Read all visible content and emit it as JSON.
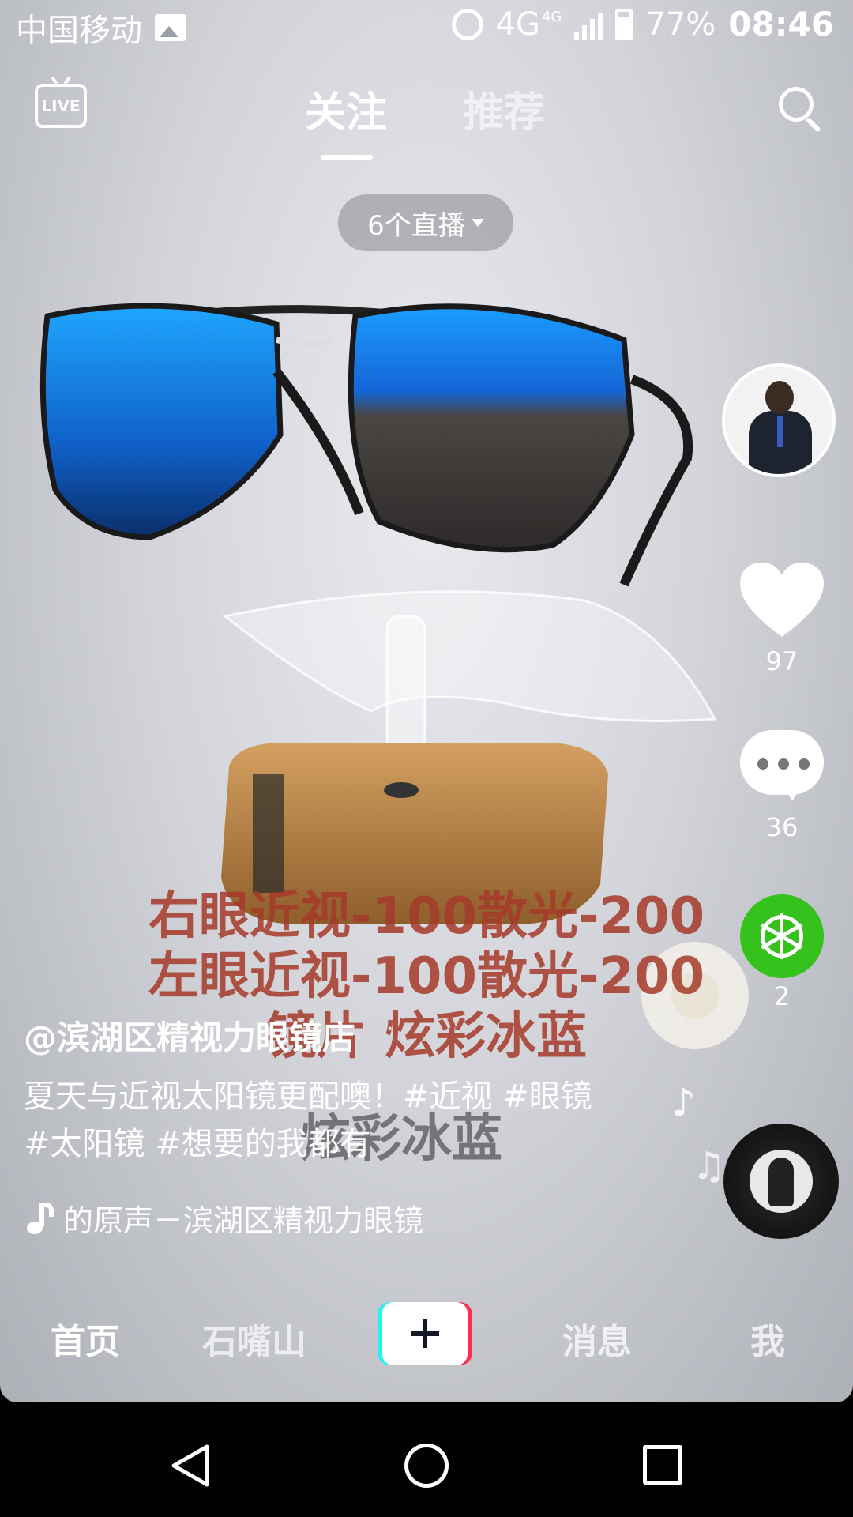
{
  "status_bar": {
    "carrier": "中国移动",
    "network": "4G",
    "network_small": "4G",
    "battery": "77%",
    "time": "08:46"
  },
  "top_nav": {
    "live_label": "LIVE",
    "tabs": [
      {
        "label": "关注",
        "active": true
      },
      {
        "label": "推荐",
        "active": false
      }
    ],
    "live_count_label": "6个直播"
  },
  "video_overlay": {
    "subtitle_lines": [
      "右眼近视-100散光-200",
      "左眼近视-100散光-200",
      "镜片  炫彩冰蓝"
    ],
    "faded_subtitle": "炫彩冰蓝"
  },
  "right_rail": {
    "like_count": "97",
    "comment_count": "36",
    "share_count": "2"
  },
  "post": {
    "author": "@滨湖区精视力眼镜店",
    "author_sep": "·",
    "description": "夏天与近视太阳镜更配噢！#近视 #眼镜 #太阳镜 #想要的我都有",
    "music": "的原声－滨湖区精视力眼镜"
  },
  "tab_bar": {
    "home": "首页",
    "city": "石嘴山",
    "messages": "消息",
    "me": "我"
  },
  "colors": {
    "share_green": "#35c21d",
    "lens_blue": "#1a7de8",
    "subtitle_red": "#a63a2a",
    "stand_gold": "#b07a3c"
  }
}
